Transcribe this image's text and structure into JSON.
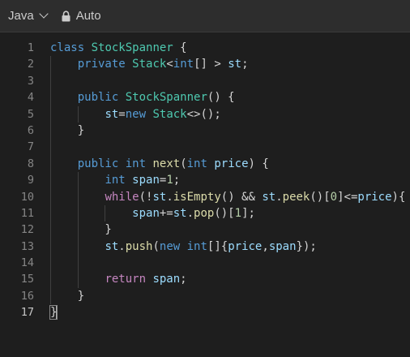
{
  "toolbar": {
    "language": "Java",
    "mode": "Auto"
  },
  "icons": {
    "language_dropdown": "chevron-down-icon",
    "mode": "lock-icon"
  },
  "colors": {
    "background": "#1e1e1e",
    "toolbar_background": "#2d2d2d",
    "keyword": "#569cd6",
    "type": "#4ec9b0",
    "function": "#dcdcaa",
    "variable": "#9cdcfe",
    "number": "#b5cea8",
    "control": "#c586c0",
    "line_number": "#858585"
  },
  "editor": {
    "cursor_line": 17,
    "lines": [
      {
        "n": "1",
        "text": "class StockSpanner {"
      },
      {
        "n": "2",
        "text": "    private Stack<int[] > st;"
      },
      {
        "n": "3",
        "text": ""
      },
      {
        "n": "4",
        "text": "    public StockSpanner() {"
      },
      {
        "n": "5",
        "text": "        st=new Stack<>();"
      },
      {
        "n": "6",
        "text": "    }"
      },
      {
        "n": "7",
        "text": ""
      },
      {
        "n": "8",
        "text": "    public int next(int price) {"
      },
      {
        "n": "9",
        "text": "        int span=1;"
      },
      {
        "n": "10",
        "text": "        while(!st.isEmpty() && st.peek()[0]<=price){"
      },
      {
        "n": "11",
        "text": "            span+=st.pop()[1];"
      },
      {
        "n": "12",
        "text": "        }"
      },
      {
        "n": "13",
        "text": "        st.push(new int[]{price,span});"
      },
      {
        "n": "14",
        "text": ""
      },
      {
        "n": "15",
        "text": "        return span;"
      },
      {
        "n": "16",
        "text": "    }"
      },
      {
        "n": "17",
        "text": "}"
      }
    ]
  }
}
